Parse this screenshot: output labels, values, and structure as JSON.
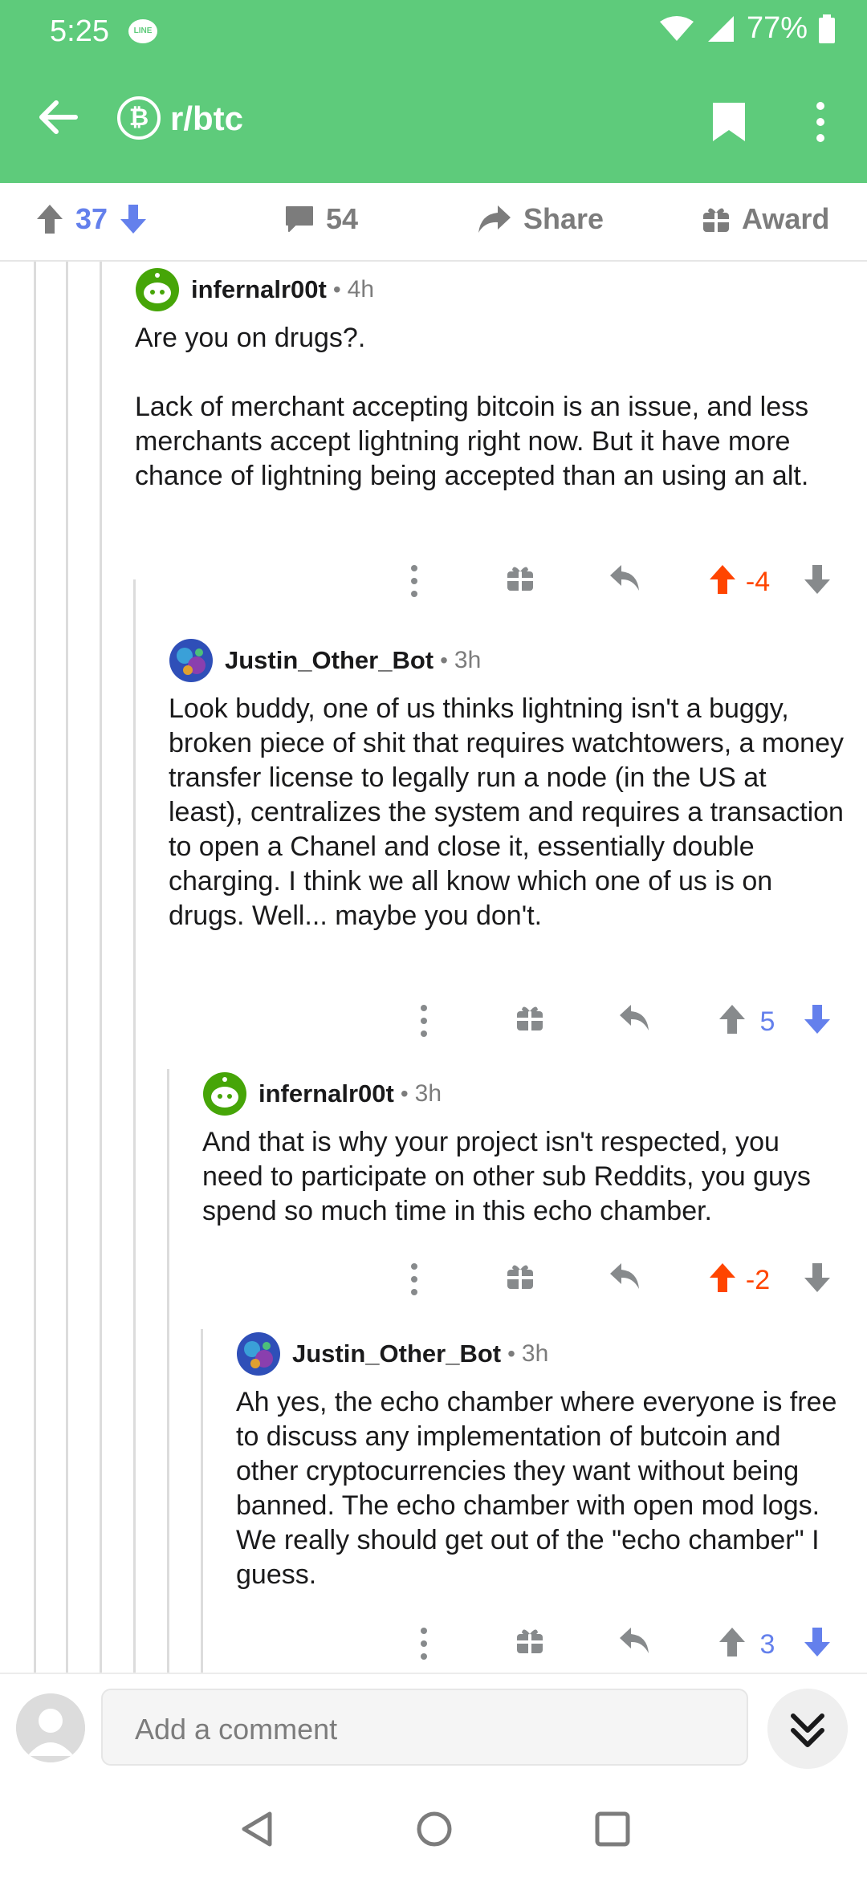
{
  "status_bar": {
    "time": "5:25",
    "battery": "77%",
    "line_badge": "LINE"
  },
  "toolbar": {
    "subreddit": "r/btc",
    "subreddit_icon": "₿"
  },
  "post_actions": {
    "score": "37",
    "comments": "54",
    "share": "Share",
    "award": "Award"
  },
  "comments": [
    {
      "author": "infernalr00t",
      "dot": "•",
      "age": "4h",
      "body": "Are you on drugs?.\n\nLack of merchant accepting bitcoin is an issue, and less merchants accept lightning right now. But it have more chance of lightning being accepted than an using an alt.",
      "score": "-4",
      "vote_state": "upvoted"
    },
    {
      "author": "Justin_Other_Bot",
      "dot": "•",
      "age": "3h",
      "body": "Look buddy, one of us thinks lightning isn't a buggy, broken piece of shit that requires watchtowers, a money transfer license to legally run a node (in the US at least), centralizes the system and requires a transaction to open a Chanel and close it, essentially double charging. I think we all know which one of us is on drugs. Well... maybe you don't.",
      "score": "5",
      "vote_state": "none"
    },
    {
      "author": "infernalr00t",
      "dot": "•",
      "age": "3h",
      "body": "And that is why your project isn't respected, you need to participate on other sub Reddits, you guys spend so much time in this echo chamber.",
      "score": "-2",
      "vote_state": "upvoted"
    },
    {
      "author": "Justin_Other_Bot",
      "dot": "•",
      "age": "3h",
      "body": "Ah yes, the echo chamber where everyone is free to discuss any implementation of butcoin and other cryptocurrencies they want without being banned. The echo chamber with open mod logs. We really should get out of the \"echo chamber\" I guess.",
      "score": "3",
      "vote_state": "none"
    }
  ],
  "composer": {
    "placeholder": "Add a comment"
  },
  "colors": {
    "brand_green": "#5ecb7b",
    "upvote_orange": "#ff4500",
    "score_blue": "#6480ec"
  },
  "icons": [
    "back-arrow-icon",
    "bitcoin-icon",
    "bookmark-icon",
    "overflow-menu-icon",
    "upvote-icon",
    "downvote-icon",
    "comment-icon",
    "share-icon",
    "gift-icon",
    "reply-icon",
    "chevron-double-down-icon"
  ]
}
